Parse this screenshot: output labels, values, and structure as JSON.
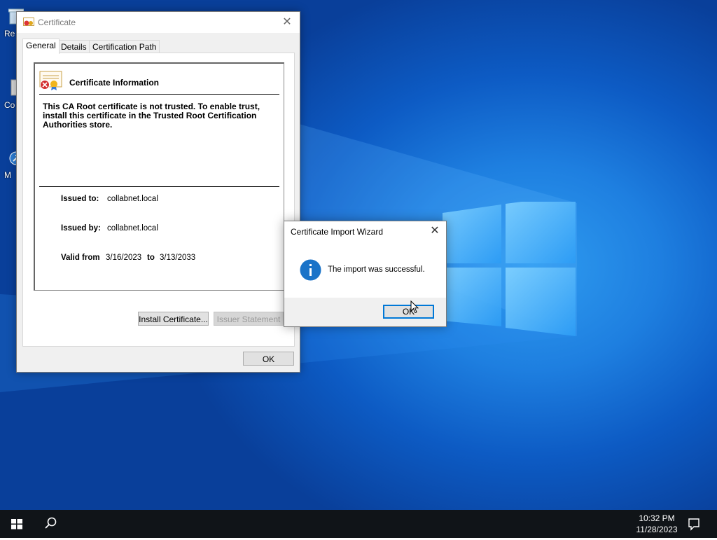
{
  "desktop": {
    "icons": [
      {
        "label": "Re"
      },
      {
        "label": "Co"
      },
      {
        "label": "M"
      }
    ]
  },
  "certificate_window": {
    "title": "Certificate",
    "tabs": [
      {
        "label": "General",
        "active": true
      },
      {
        "label": "Details",
        "active": false
      },
      {
        "label": "Certification Path",
        "active": false
      }
    ],
    "info_title": "Certificate Information",
    "warning_text": "This CA Root certificate is not trusted. To enable trust, install this certificate in the Trusted Root Certification Authorities store.",
    "issued_to_label": "Issued to:",
    "issued_to_value": "collabnet.local",
    "issued_by_label": "Issued by:",
    "issued_by_value": "collabnet.local",
    "valid_from_label": "Valid from",
    "valid_from_value": "3/16/2023",
    "valid_to_label": "to",
    "valid_to_value": "3/13/2033",
    "install_button": "Install Certificate...",
    "issuer_statement_button": "Issuer Statement",
    "ok_button": "OK"
  },
  "wizard_dialog": {
    "title": "Certificate Import Wizard",
    "message": "The import was successful.",
    "ok_button": "OK"
  },
  "taskbar": {
    "time": "10:32 PM",
    "date": "11/28/2023"
  },
  "colors": {
    "accent": "#0078d7",
    "taskbar": "#101418",
    "desktop": "#1e7fe0"
  }
}
